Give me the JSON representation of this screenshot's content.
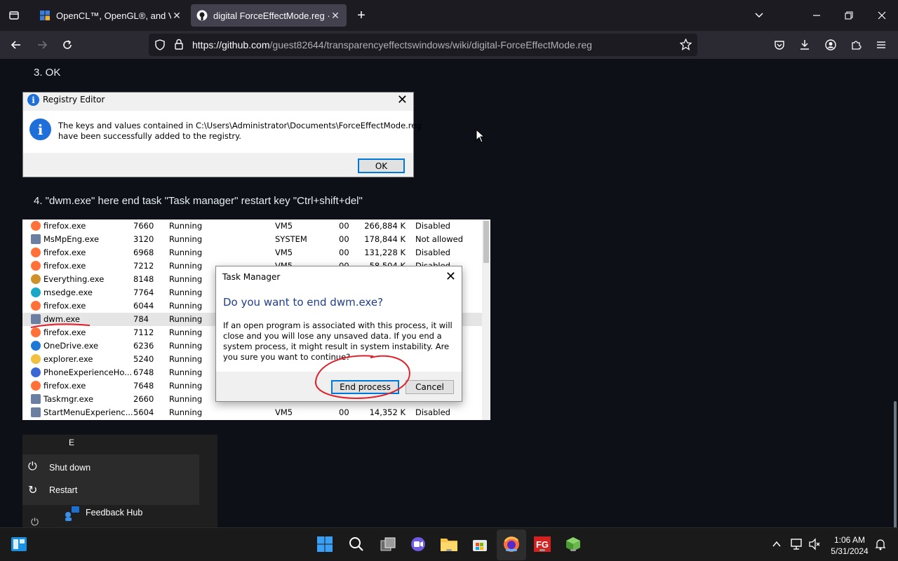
{
  "browser": {
    "tabs": [
      {
        "title": "OpenCL™, OpenGL®, and Vulk",
        "active": false
      },
      {
        "title": "digital ForceEffectMode.reg · g",
        "active": true
      }
    ],
    "url_domain": "https://github.com",
    "url_path": "/guest82644/transparencyeffectswindows/wiki/digital-ForceEffectMode.reg"
  },
  "content": {
    "step3": "3. OK",
    "step4": "4. \"dwm.exe\" here end task \"Task manager\" restart key \"Ctrl+shift+del\""
  },
  "registry_dialog": {
    "title": "Registry Editor",
    "message_line1": "The keys and values contained in C:\\Users\\Administrator\\Documents\\ForceEffectMode.reg",
    "message_line2": "have been successfully added to the registry.",
    "ok": "OK"
  },
  "task_manager": {
    "rows": [
      {
        "name": "firefox.exe",
        "pid": "7660",
        "status": "Running",
        "user": "VM5",
        "cpu": "00",
        "mem": "266,884 K",
        "uac": "Disabled",
        "icon": "firefox"
      },
      {
        "name": "MsMpEng.exe",
        "pid": "3120",
        "status": "Running",
        "user": "SYSTEM",
        "cpu": "00",
        "mem": "178,844 K",
        "uac": "Not allowed",
        "icon": "app"
      },
      {
        "name": "firefox.exe",
        "pid": "6968",
        "status": "Running",
        "user": "VM5",
        "cpu": "00",
        "mem": "131,228 K",
        "uac": "Disabled",
        "icon": "firefox"
      },
      {
        "name": "firefox.exe",
        "pid": "7212",
        "status": "Running",
        "user": "VM5",
        "cpu": "00",
        "mem": "58,504 K",
        "uac": "Disabled",
        "icon": "firefox"
      },
      {
        "name": "Everything.exe",
        "pid": "8148",
        "status": "Running",
        "user": "",
        "cpu": "",
        "mem": "",
        "uac": "",
        "icon": "search"
      },
      {
        "name": "msedge.exe",
        "pid": "7764",
        "status": "Running",
        "user": "",
        "cpu": "",
        "mem": "",
        "uac": "",
        "icon": "edge"
      },
      {
        "name": "firefox.exe",
        "pid": "6044",
        "status": "Running",
        "user": "",
        "cpu": "",
        "mem": "",
        "uac": "",
        "icon": "firefox"
      },
      {
        "name": "dwm.exe",
        "pid": "784",
        "status": "Running",
        "user": "",
        "cpu": "",
        "mem": "",
        "uac": "",
        "icon": "app"
      },
      {
        "name": "firefox.exe",
        "pid": "7112",
        "status": "Running",
        "user": "",
        "cpu": "",
        "mem": "",
        "uac": "",
        "icon": "firefox"
      },
      {
        "name": "OneDrive.exe",
        "pid": "6236",
        "status": "Running",
        "user": "",
        "cpu": "",
        "mem": "",
        "uac": "",
        "icon": "cloud"
      },
      {
        "name": "explorer.exe",
        "pid": "5240",
        "status": "Running",
        "user": "",
        "cpu": "",
        "mem": "",
        "uac": "",
        "icon": "folder"
      },
      {
        "name": "PhoneExperienceHo...",
        "pid": "6748",
        "status": "Running",
        "user": "",
        "cpu": "",
        "mem": "",
        "uac": "",
        "icon": "phone"
      },
      {
        "name": "firefox.exe",
        "pid": "7648",
        "status": "Running",
        "user": "",
        "cpu": "",
        "mem": "",
        "uac": "",
        "icon": "firefox"
      },
      {
        "name": "Taskmgr.exe",
        "pid": "2660",
        "status": "Running",
        "user": "",
        "cpu": "",
        "mem": "",
        "uac": "",
        "icon": "app"
      },
      {
        "name": "StartMenuExperienc...",
        "pid": "5604",
        "status": "Running",
        "user": "VM5",
        "cpu": "00",
        "mem": "14,352 K",
        "uac": "Disabled",
        "icon": "app"
      }
    ],
    "selected_index": 7,
    "dialog": {
      "title": "Task Manager",
      "question": "Do you want to end dwm.exe?",
      "message": "If an open program is associated with this process, it will close and you will lose any unsaved data. If you end a system process, it might result in system instability. Are you sure you want to continue?",
      "end_process": "End process",
      "cancel": "Cancel"
    }
  },
  "start_menu": {
    "header_letter": "E",
    "shutdown": "Shut down",
    "restart": "Restart",
    "feedback_hub": "Feedback Hub"
  },
  "taskbar": {
    "time": "1:06 AM",
    "date": "5/31/2024",
    "fg_label": "FG"
  },
  "colors": {
    "accent_blue": "#0078d7",
    "annotation_red": "#e0202a",
    "page_bg": "#0d1117"
  }
}
